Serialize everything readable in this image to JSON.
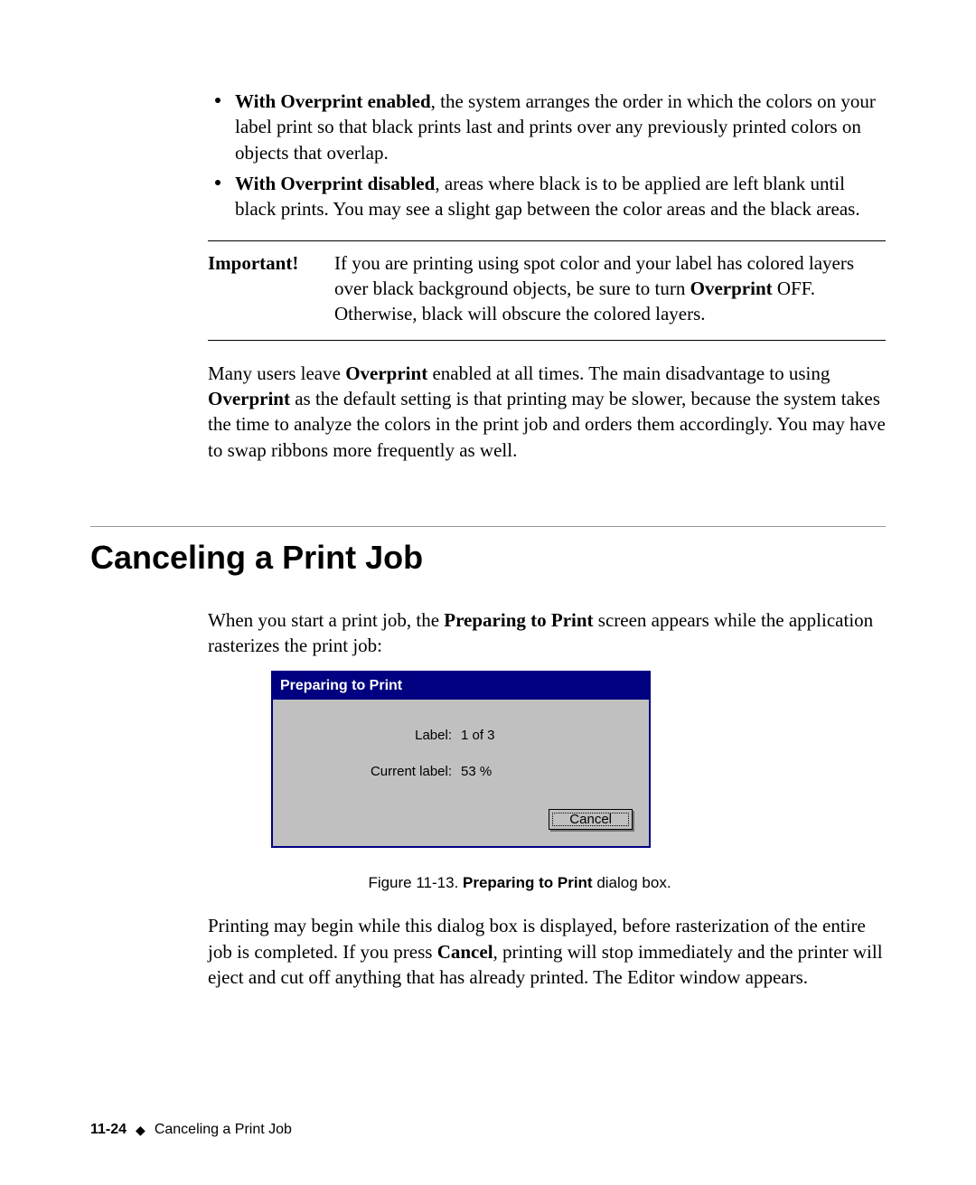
{
  "bullets": [
    {
      "lead": "With Overprint enabled",
      "rest": ", the system arranges the order in which the colors on your label print so that black prints last and prints over any previously printed colors on objects that overlap."
    },
    {
      "lead": "With Overprint disabled",
      "rest": ", areas where black is to be applied are left blank until black prints. You may see a slight gap between the color areas and the black areas."
    }
  ],
  "note": {
    "label": "Important!",
    "pre": "If you are printing using spot color and your label has colored layers over black background objects, be sure to turn ",
    "bold": "Overprint",
    "post": " OFF. Otherwise, black will obscure the colored layers."
  },
  "para1": {
    "pre": "Many users leave ",
    "b1": "Overprint",
    "mid": " enabled at all times. The main disadvantage to using ",
    "b2": "Overprint",
    "post": " as the default setting is that printing may be slower, because the system takes the time to analyze the colors in the print job and orders them accordingly. You may have to swap ribbons more frequently as well."
  },
  "section_title": "Canceling a Print Job",
  "para2": {
    "pre": "When you start a print job, the ",
    "b": "Preparing to Print",
    "post": " screen appears while the application rasterizes the print job:"
  },
  "dialog": {
    "title": "Preparing to Print",
    "rows": [
      {
        "label": "Label:",
        "value": "1 of 3"
      },
      {
        "label": "Current label:",
        "value": "53 %"
      }
    ],
    "cancel": "Cancel"
  },
  "figure": {
    "num": "Figure 11-13. ",
    "bold": "Preparing to Print",
    "rest": " dialog box."
  },
  "para3": {
    "pre": "Printing may begin while this dialog box is displayed, before rasterization of the entire job is completed. If you press ",
    "b": "Cancel",
    "post": ", printing will stop immediately and the printer will eject and cut off anything that has already printed. The Editor window appears."
  },
  "footer": {
    "page": "11-24",
    "section": "Canceling a Print Job"
  }
}
